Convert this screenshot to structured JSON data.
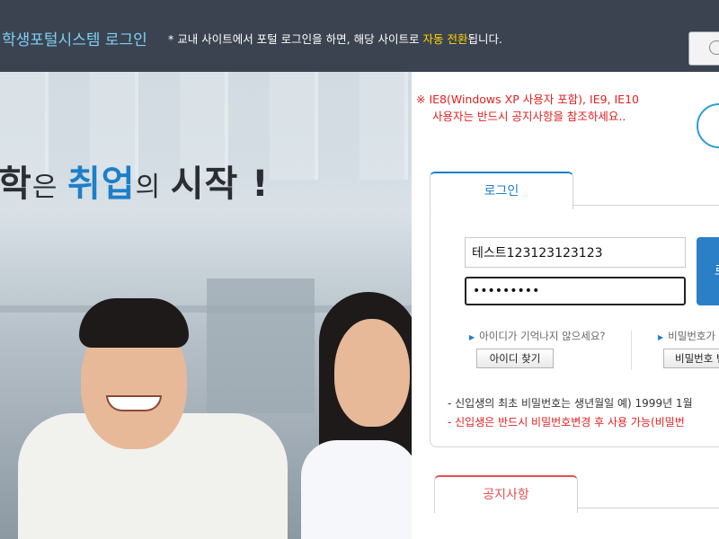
{
  "header": {
    "title": "학생포털시스템 로그인",
    "notice_prefix": "* 교내 사이트에서 포털 로그인을 하면, 해당 사이트로 ",
    "notice_highlight": "자동 전환",
    "notice_suffix": "됩니다."
  },
  "hero": {
    "slogan_a": "학",
    "slogan_b": "은 ",
    "slogan_c": "취업",
    "slogan_d": "의 ",
    "slogan_e": "시작 !"
  },
  "warning": {
    "line1": "※ IE8(Windows XP 사용자 포함), IE9, IE10",
    "line2": "사용자는 반드시 공지사항을 참조하세요.."
  },
  "login": {
    "tab_label": "로그인",
    "id_value": "테스트123123123123",
    "pw_value": "•••••••••",
    "button_label": "로",
    "help_id_text": "아이디가 기억나지 않으세요?",
    "find_id_label": "아이디 찾기",
    "help_pw_text": "비밀번호가 기",
    "find_pw_label": "비밀번호 변",
    "note1": "- 신입생의 최초 비밀번호는 생년월일 예) 1999년 1월",
    "note2": "- 신입생은 반드시 비밀번호변경 후 사용 가능(비밀번"
  },
  "notice": {
    "tab_label": "공지사항"
  },
  "colors": {
    "header_bg": "#3b4350",
    "title_color": "#7fd0f5",
    "highlight": "#ffd400",
    "accent_blue": "#1d7fc8",
    "warning_red": "#e02020"
  }
}
